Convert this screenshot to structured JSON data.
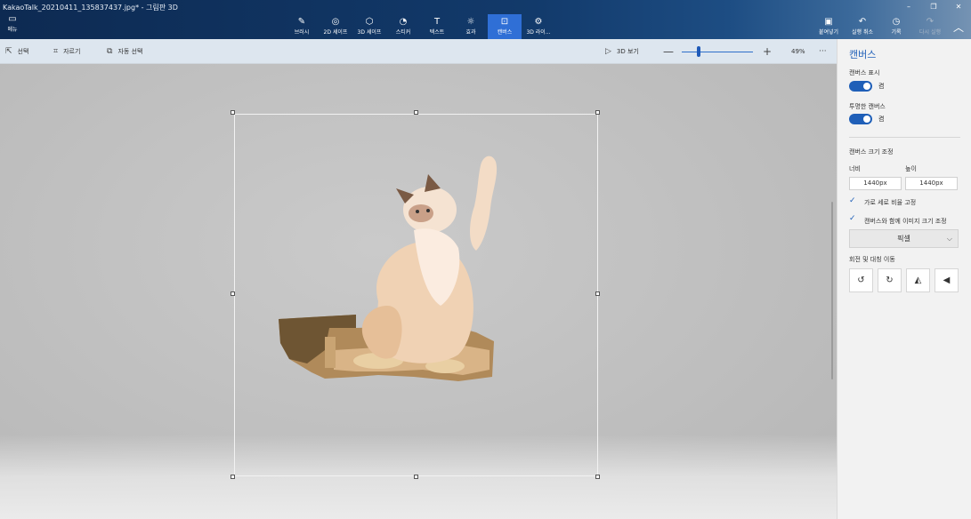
{
  "window": {
    "title": "KakaoTalk_20210411_135837437.jpg* - 그림판 3D",
    "minimize_icon": "–",
    "restore_icon": "❐",
    "close_icon": "✕"
  },
  "menu": {
    "label": "메뉴",
    "icon": "folder-icon"
  },
  "ribbon": {
    "tools": [
      {
        "label": "브러시",
        "icon": "brush-icon"
      },
      {
        "label": "2D 셰이프",
        "icon": "2d-shapes-icon"
      },
      {
        "label": "3D 셰이프",
        "icon": "3d-shapes-icon"
      },
      {
        "label": "스티커",
        "icon": "sticker-icon"
      },
      {
        "label": "텍스트",
        "icon": "text-icon"
      },
      {
        "label": "효과",
        "icon": "effects-icon"
      },
      {
        "label": "캔버스",
        "icon": "canvas-icon",
        "active": true
      },
      {
        "label": "3D 라이...",
        "icon": "3d-library-icon"
      }
    ],
    "right_tools": [
      {
        "label": "붙여넣기",
        "icon": "paste-icon"
      },
      {
        "label": "실행 취소",
        "icon": "undo-icon"
      },
      {
        "label": "기록",
        "icon": "history-icon"
      },
      {
        "label": "다시 실행",
        "icon": "redo-icon",
        "disabled": true
      }
    ]
  },
  "subtoolbar": {
    "select_label": "선택",
    "crop_label": "자르기",
    "magic_select_label": "자동 선택",
    "view3d_label": "3D 보기",
    "zoom_percent": "49%",
    "zoom_minus": "—",
    "zoom_plus": "+",
    "more": "···"
  },
  "panel": {
    "title": "캔버스",
    "show_canvas_label": "캔버스 표시",
    "show_canvas_state": "켬",
    "transparent_canvas_label": "투명한 캔버스",
    "transparent_canvas_state": "켬",
    "resize_section_label": "캔버스 크기 조정",
    "width_label": "너비",
    "height_label": "높이",
    "width_value": "1440px",
    "height_value": "1440px",
    "lock_aspect_label": "가로 세로 비율 고정",
    "resize_image_label": "캔버스와 함께 이미지 크기 조정",
    "unit_select": "픽셀",
    "rotate_flip_label": "회전 및 대칭 이동",
    "check_icon": "✓",
    "chevron_icon": "⌵",
    "rotate_buttons": [
      "rotate-left-icon",
      "rotate-right-icon",
      "flip-horizontal-icon",
      "flip-vertical-icon"
    ]
  },
  "colors": {
    "accent": "#1f5fb8",
    "titlebar": "#123a6b",
    "active_tool": "#2f6fd6",
    "panel_bg": "#f2f2f2",
    "workspace": "#c4c4c4"
  }
}
